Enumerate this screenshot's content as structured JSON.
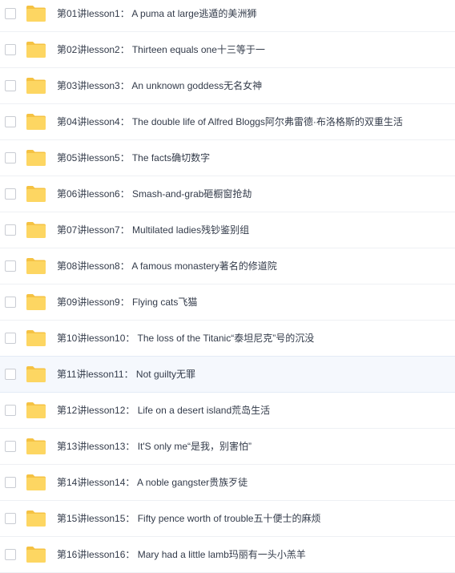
{
  "file_list": {
    "items": [
      {
        "name": "第01讲lesson1： A puma at large逃遁的美洲狮",
        "icon": "folder-icon"
      },
      {
        "name": "第02讲lesson2： Thirteen equals one十三等于一",
        "icon": "folder-icon"
      },
      {
        "name": "第03讲lesson3： An unknown goddess无名女神",
        "icon": "folder-icon"
      },
      {
        "name": "第04讲lesson4： The double life of Alfred Bloggs阿尔弗雷德·布洛格斯的双重生活",
        "icon": "folder-icon"
      },
      {
        "name": "第05讲lesson5： The facts确切数字",
        "icon": "folder-icon"
      },
      {
        "name": "第06讲lesson6： Smash-and-grab砸橱窗抢劫",
        "icon": "folder-icon"
      },
      {
        "name": "第07讲lesson7： Multilated ladies残钞鉴别组",
        "icon": "folder-icon"
      },
      {
        "name": "第08讲lesson8： A famous monastery著名的修道院",
        "icon": "folder-icon"
      },
      {
        "name": "第09讲lesson9： Flying cats飞猫",
        "icon": "folder-icon"
      },
      {
        "name": "第10讲lesson10： The loss of the Titanic“泰坦尼克”号的沉没",
        "icon": "folder-icon"
      },
      {
        "name": "第11讲lesson11： Not guilty无罪",
        "icon": "folder-icon",
        "selected": true
      },
      {
        "name": "第12讲lesson12： Life on a desert island荒岛生活",
        "icon": "folder-icon"
      },
      {
        "name": "第13讲lesson13： It'S only me“是我，别害怕”",
        "icon": "folder-icon"
      },
      {
        "name": "第14讲lesson14： A noble gangster贵族歹徒",
        "icon": "folder-icon"
      },
      {
        "name": "第15讲lesson15： Fifty pence worth of trouble五十便士的麻烦",
        "icon": "folder-icon"
      },
      {
        "name": "第16讲lesson16： Mary had a little lamb玛丽有一头小羔羊",
        "icon": "folder-icon"
      }
    ]
  },
  "colors": {
    "folder_body": "#fdd662",
    "folder_tab": "#f5c243",
    "text": "#333b4a",
    "row_border": "#eef0f4",
    "selected_bg": "#f5f8fd"
  }
}
